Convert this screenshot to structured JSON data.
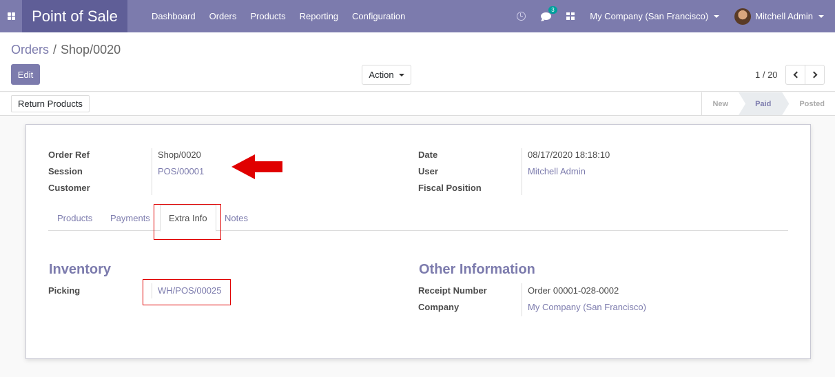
{
  "navbar": {
    "brand": "Point of Sale",
    "menu": [
      "Dashboard",
      "Orders",
      "Products",
      "Reporting",
      "Configuration"
    ],
    "chat_badge": "3",
    "company": "My Company (San Francisco)",
    "user": "Mitchell Admin",
    "accent_color": "#7c7bad"
  },
  "breadcrumb": {
    "parent": "Orders",
    "separator": "/",
    "current": "Shop/0020"
  },
  "control": {
    "edit_label": "Edit",
    "action_label": "Action",
    "pager": "1 / 20"
  },
  "statusbar": {
    "return_label": "Return Products",
    "stages": [
      "New",
      "Paid",
      "Posted"
    ],
    "active_stage": "Paid"
  },
  "form": {
    "left_fields": [
      {
        "label": "Order Ref",
        "value": "Shop/0020"
      },
      {
        "label": "Session",
        "value": "POS/00001"
      },
      {
        "label": "Customer",
        "value": ""
      }
    ],
    "right_fields": [
      {
        "label": "Date",
        "value": "08/17/2020 18:18:10"
      },
      {
        "label": "User",
        "value": "Mitchell Admin"
      },
      {
        "label": "Fiscal Position",
        "value": ""
      }
    ],
    "tabs": [
      "Products",
      "Payments",
      "Extra Info",
      "Notes"
    ],
    "active_tab": "Extra Info",
    "inventory": {
      "title": "Inventory",
      "picking_label": "Picking",
      "picking_value": "WH/POS/00025"
    },
    "other_info": {
      "title": "Other Information",
      "receipt_label": "Receipt Number",
      "receipt_value": "Order 00001-028-0002",
      "company_label": "Company",
      "company_value": "My Company (San Francisco)"
    }
  },
  "annotation": {
    "highlight_color": "#e00000"
  }
}
